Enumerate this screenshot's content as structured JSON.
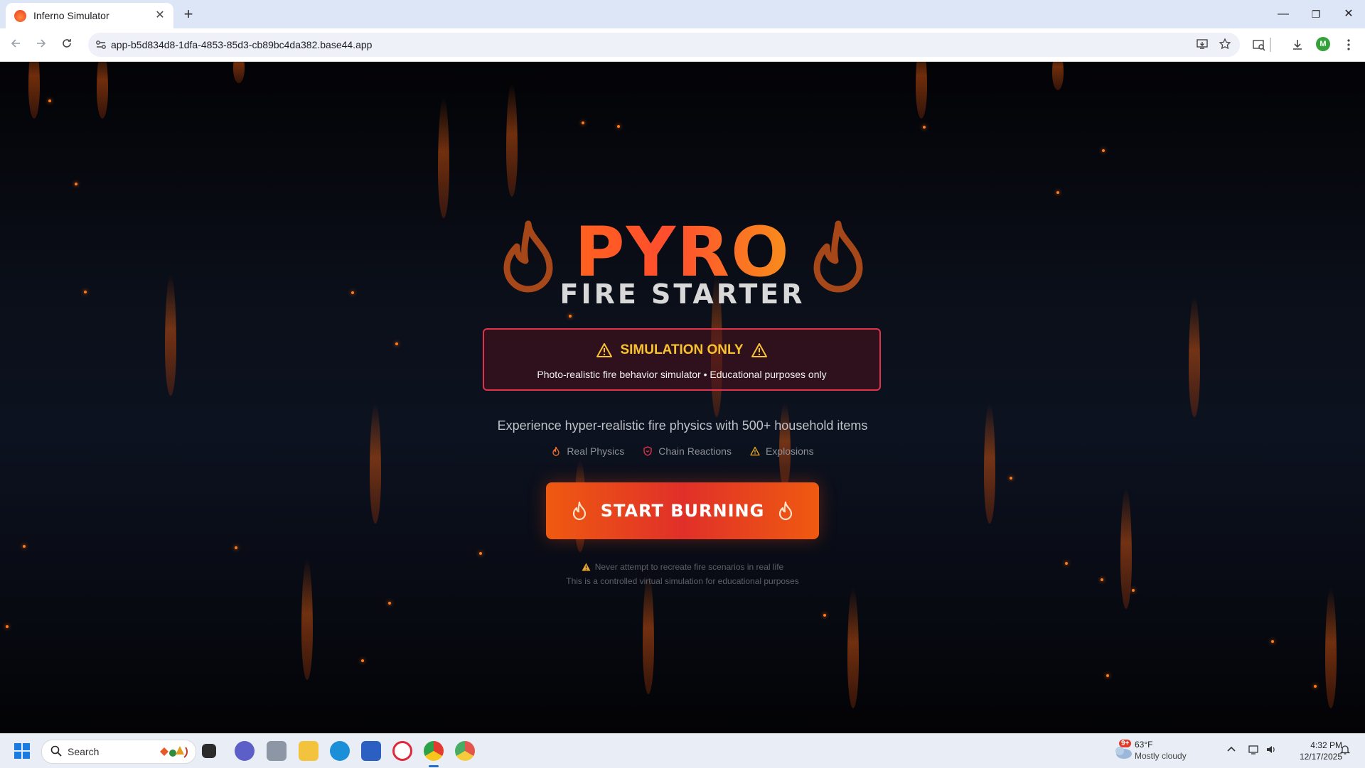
{
  "browser": {
    "tab_title": "Inferno Simulator",
    "tab_close": "✕",
    "new_tab": "+",
    "url": "app-b5d834d8-1dfa-4853-85d3-cb89bc4da382.base44.app",
    "window_controls": [
      "—",
      "❐",
      "✕"
    ]
  },
  "page": {
    "logo": "PYRO",
    "subtitle": "FIRE STARTER",
    "warning": {
      "title": "SIMULATION ONLY",
      "subtitle": "Photo-realistic fire behavior simulator • Educational purposes only"
    },
    "tagline": "Experience hyper-realistic fire physics with 500+ household items",
    "features": [
      {
        "label": "Real Physics",
        "icon": "flame-icon"
      },
      {
        "label": "Chain Reactions",
        "icon": "shield-icon"
      },
      {
        "label": "Explosions",
        "icon": "warning-icon"
      }
    ],
    "cta_label": "START BURNING",
    "disclaimer_line1": "Never attempt to recreate fire scenarios in real life",
    "disclaimer_line2": "This is a controlled virtual simulation for educational purposes",
    "colors": {
      "accent_orange": "#ef5a10",
      "accent_red": "#e03029",
      "warning_yellow": "#f9c22f",
      "warning_border": "#e0334b"
    }
  },
  "taskbar": {
    "search_label": "Search",
    "weather_badge": "9+",
    "weather_temp": "63°F",
    "weather_desc": "Mostly cloudy",
    "time": "4:32 PM",
    "date": "12/17/2025"
  }
}
